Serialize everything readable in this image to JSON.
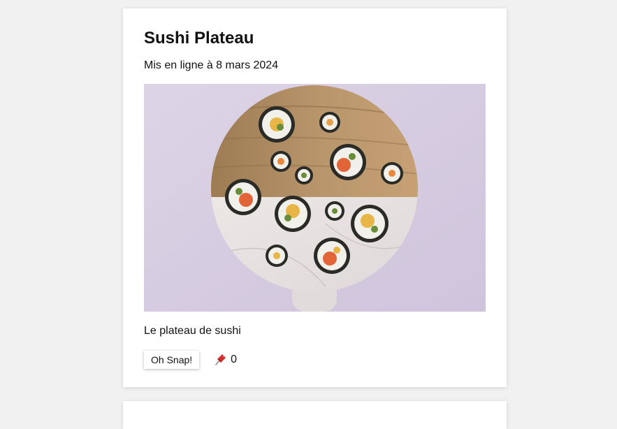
{
  "post": {
    "title": "Sushi Plateau",
    "date": "Mis en ligne à 8 mars 2024",
    "image_description": "",
    "caption": "Le plateau de sushi",
    "snap_button": "Oh Snap!",
    "pin_icon": "pushpin-icon",
    "pin_count": "0"
  },
  "colors": {
    "background": "#f1f1f1",
    "card": "#ffffff",
    "text": "#111111",
    "pin": "#d62b2b"
  }
}
